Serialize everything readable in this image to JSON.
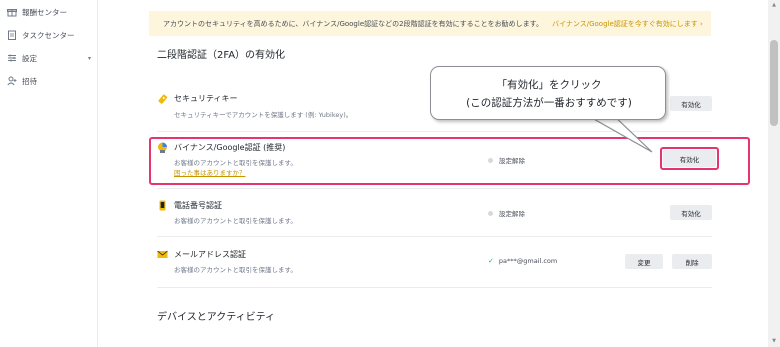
{
  "sidebar": {
    "items": [
      {
        "label": "報酬センター",
        "icon": "gift-icon"
      },
      {
        "label": "タスクセンター",
        "icon": "task-icon"
      },
      {
        "label": "設定",
        "icon": "settings-icon",
        "chevron": "▾"
      },
      {
        "label": "招待",
        "icon": "invite-icon"
      }
    ]
  },
  "banner": {
    "text": "アカウントのセキュリティを高めるために、バイナンス/Google認証などの2段階認証を有効にすることをお勧めします。",
    "link": "バイナンス/Google認証を今すぐ有効にします ›"
  },
  "section_2fa": {
    "title": "二段階認証（2FA）の有効化"
  },
  "methods": [
    {
      "name": "セキュリティキー",
      "desc": "セキュリティキーでアカウントを保護します (例: Yubikey)。",
      "status": "",
      "buttons": [
        "有効化"
      ],
      "icon": "security-key-icon"
    },
    {
      "name": "バイナンス/Google認証 (推奨)",
      "desc": "お客様のアカウントと取引を保護します。",
      "help": "困った事はありますか？",
      "status": "設定解除",
      "buttons": [
        "有効化"
      ],
      "icon": "authenticator-icon"
    },
    {
      "name": "電話番号認証",
      "desc": "お客様のアカウントと取引を保護します。",
      "status": "設定解除",
      "buttons": [
        "有効化"
      ],
      "icon": "phone-icon"
    },
    {
      "name": "メールアドレス認証",
      "desc": "お客様のアカウントと取引を保護します。",
      "status": "pa***@gmail.com",
      "buttons": [
        "変更",
        "削除"
      ],
      "icon": "email-icon"
    }
  ],
  "section_devices": {
    "title": "デバイスとアクティビティ"
  },
  "callout": {
    "line1": "「有効化」をクリック",
    "line2": "(この認証方法が一番おすすめです)"
  },
  "colors": {
    "accent": "#c99400",
    "highlight": "#e5356f",
    "banner_bg": "#fdf5dc",
    "button_bg": "#eaecef",
    "check": "#02c076"
  }
}
